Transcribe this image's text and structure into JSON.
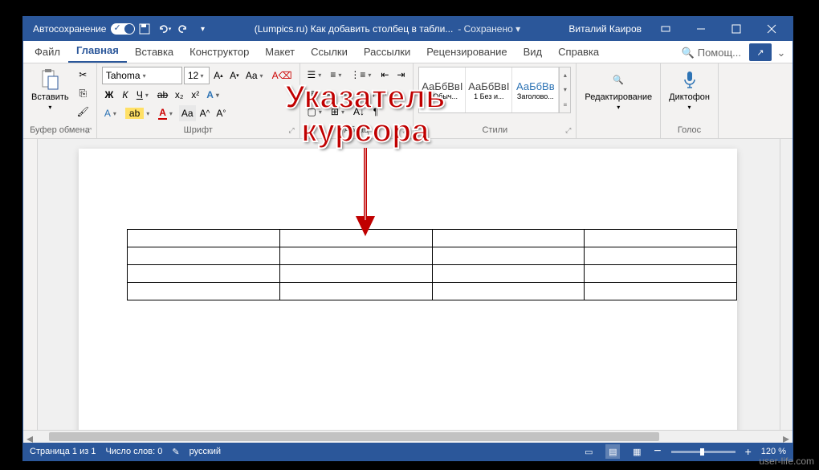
{
  "titlebar": {
    "autosave": "Автосохранение",
    "doc_title": "(Lumpics.ru) Как добавить столбец в табли...",
    "saved_state": "- Сохранено ▾",
    "user": "Виталий Каиров"
  },
  "tabs": {
    "file": "Файл",
    "home": "Главная",
    "insert": "Вставка",
    "design": "Конструктор",
    "layout": "Макет",
    "references": "Ссылки",
    "mailings": "Рассылки",
    "review": "Рецензирование",
    "view": "Вид",
    "help": "Справка",
    "search": "Помощ..."
  },
  "ribbon": {
    "clipboard": {
      "paste": "Вставить",
      "label": "Буфер обмена"
    },
    "font": {
      "name": "Tahoma",
      "size": "12",
      "bold": "Ж",
      "italic": "К",
      "underline": "Ч",
      "strike": "ab",
      "sub": "x₂",
      "sup": "x²",
      "label": "Шрифт"
    },
    "paragraph": {
      "label": "Абзац"
    },
    "styles": {
      "style1": "АаБбВвI",
      "style1_name": "1 Обыч...",
      "style2": "АаБбВвI",
      "style2_name": "1 Без и...",
      "style3": "АаБбВв",
      "style3_name": "Заголово...",
      "label": "Стили"
    },
    "editing": {
      "label": "Редактирование"
    },
    "voice": {
      "dictate": "Диктофон",
      "label": "Голос"
    }
  },
  "statusbar": {
    "page": "Страница 1 из 1",
    "words": "Число слов: 0",
    "lang": "русский",
    "zoom": "120 %"
  },
  "annotation": {
    "line1": "Указатель",
    "line2": "курсора"
  },
  "watermark": "user-life.com",
  "table": {
    "rows": 4,
    "cols": 4
  }
}
